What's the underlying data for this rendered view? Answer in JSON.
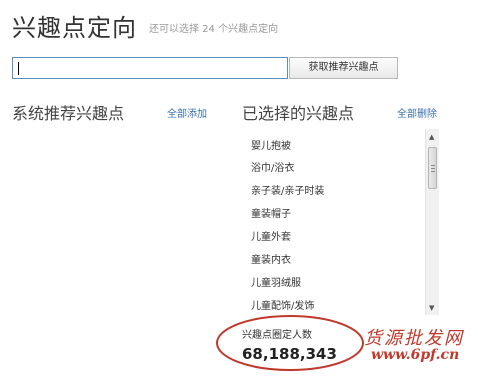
{
  "header": {
    "title": "兴趣点定向",
    "subtitle": "还可以选择 24 个兴趣点定向"
  },
  "search": {
    "value": "",
    "fetch_button": "获取推荐兴趣点"
  },
  "recommended": {
    "title": "系统推荐兴趣点",
    "add_all": "全部添加"
  },
  "selected": {
    "title": "已选择的兴趣点",
    "remove_all": "全部删除",
    "items": [
      "婴儿抱被",
      "浴巾/浴衣",
      "亲子装/亲子时装",
      "童装帽子",
      "儿童外套",
      "童装内衣",
      "儿童羽绒服",
      "儿童配饰/发饰"
    ]
  },
  "audience": {
    "label": "兴趣点圈定人数",
    "value": "68,188,343"
  },
  "watermark": {
    "text": "货源批发网",
    "url": "www.6pf.cn"
  },
  "colors": {
    "accent_link": "#3a6fb0",
    "highlight_ellipse": "#c0392b",
    "input_border": "#5b8ec0"
  }
}
